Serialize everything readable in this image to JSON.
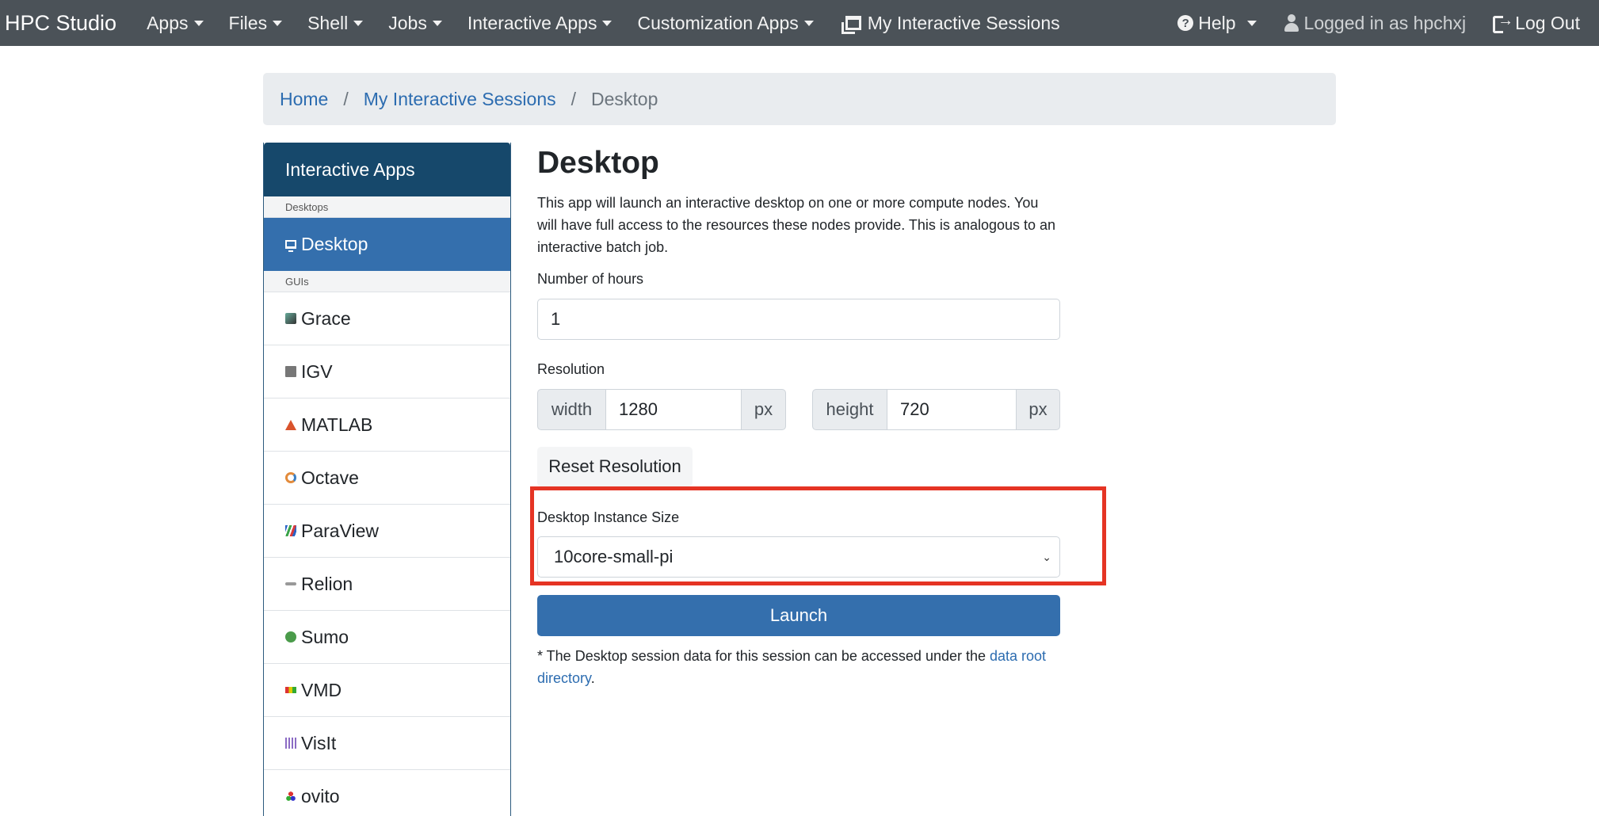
{
  "navbar": {
    "brand": "HPC Studio",
    "menus": [
      "Apps",
      "Files",
      "Shell",
      "Jobs",
      "Interactive Apps",
      "Customization Apps"
    ],
    "sessions_link": "My Interactive Sessions",
    "help": "Help",
    "logged_in": "Logged in as hpchxj",
    "logout": "Log Out"
  },
  "breadcrumb": {
    "home": "Home",
    "sessions": "My Interactive Sessions",
    "current": "Desktop"
  },
  "sidebar": {
    "header": "Interactive Apps",
    "group_desktops": "Desktops",
    "desktop": "Desktop",
    "group_guis": "GUIs",
    "items": [
      "Grace",
      "IGV",
      "MATLAB",
      "Octave",
      "ParaView",
      "Relion",
      "Sumo",
      "VMD",
      "VisIt",
      "ovito"
    ]
  },
  "main": {
    "title": "Desktop",
    "description": "This app will launch an interactive desktop on one or more compute nodes. You will have full access to the resources these nodes provide. This is analogous to an interactive batch job.",
    "hours_label": "Number of hours",
    "hours_value": "1",
    "resolution_label": "Resolution",
    "width_addon": "width",
    "width_value": "1280",
    "px": "px",
    "height_addon": "height",
    "height_value": "720",
    "reset_button": "Reset Resolution",
    "instance_label": "Desktop Instance Size",
    "instance_value": "10core-small-pi",
    "launch_button": "Launch",
    "note_prefix": "* The Desktop session data for this session can be accessed under the ",
    "note_link": "data root directory",
    "note_suffix": "."
  },
  "colors": {
    "navbar": "#4b5258",
    "sidebar_header": "#16486b",
    "active": "#346fad",
    "highlight": "#e53424",
    "link": "#2c6cb0"
  }
}
